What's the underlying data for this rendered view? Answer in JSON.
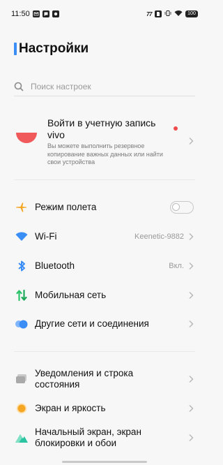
{
  "status_bar": {
    "time": "11:50",
    "signal": "77",
    "battery": "100"
  },
  "page": {
    "title": "Настройки"
  },
  "search": {
    "placeholder": "Поиск настроек"
  },
  "account": {
    "title": "Войти в учетную запись vivo",
    "subtitle": "Вы можете выполнить резервное копирование важных данных или найти свои устройства"
  },
  "connectivity": [
    {
      "label": "Режим полета",
      "icon": "airplane-icon",
      "color": "#f5a623"
    },
    {
      "label": "Wi-Fi",
      "value": "Keenetic-9882",
      "icon": "wifi-icon",
      "color": "#3a8ef6"
    },
    {
      "label": "Bluetooth",
      "value": "Вкл.",
      "icon": "bluetooth-icon",
      "color": "#3a8ef6"
    },
    {
      "label": "Мобильная сеть",
      "icon": "mobile-network-icon",
      "color": "#2bc46a"
    },
    {
      "label": "Другие сети и соединения",
      "icon": "other-networks-icon",
      "color": "#3a8ef6"
    }
  ],
  "system": [
    {
      "label": "Уведомления и строка состояния",
      "icon": "notifications-icon",
      "color": "#b8b8b8"
    },
    {
      "label": "Экран и яркость",
      "icon": "display-icon",
      "color": "#f5a623"
    },
    {
      "label": "Начальный экран, экран блокировки и обои",
      "icon": "wallpaper-icon",
      "color": "#2bc4a0"
    }
  ]
}
